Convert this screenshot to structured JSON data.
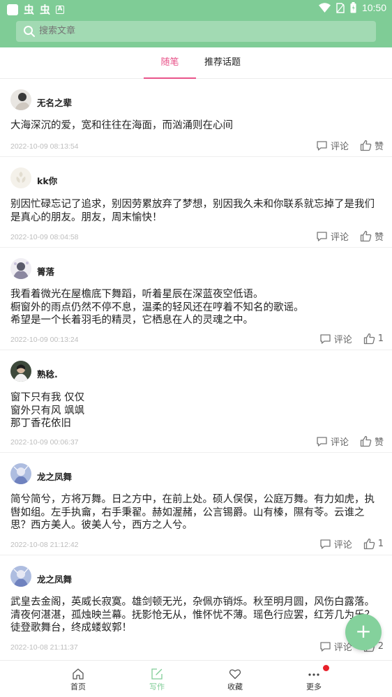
{
  "status_bar": {
    "left_glyphs": [
      "虫",
      "虫"
    ],
    "a_icon_letter": "A",
    "time": "10:50"
  },
  "search": {
    "placeholder": "搜索文章"
  },
  "tabs": [
    {
      "label": "随笔",
      "active": true
    },
    {
      "label": "推荐话题",
      "active": false
    }
  ],
  "posts": [
    {
      "username": "无名之辈",
      "content": "大海深沉的爱，宽和往往在海面，而汹涌则在心间",
      "timestamp": "2022-10-09 08:13:54",
      "comment_label": "评论",
      "like_label": "赞"
    },
    {
      "username": "kk你",
      "content": "别因忙碌忘记了追求，别因劳累放弃了梦想，别因我久未和你联系就忘掉了是我们是真心的朋友。朋友，周末愉快！",
      "timestamp": "2022-10-09 08:04:58",
      "comment_label": "评论",
      "like_label": "赞"
    },
    {
      "username": "箐落",
      "content": "我看着微光在屋檐底下舞蹈，听着星辰在深蓝夜空低语。\n橱窗外的雨点仍然不停不息，温柔的轻风还在哼着不知名的歌谣。\n希望是一个长着羽毛的精灵，它栖息在人的灵魂之中。",
      "timestamp": "2022-10-09 00:13:24",
      "comment_label": "评论",
      "like_label": "1"
    },
    {
      "username": "熟稔.",
      "content": "窗下只有我   仅仅\n窗外只有风    飒飒\n那丁香花依旧",
      "timestamp": "2022-10-09 00:06:37",
      "comment_label": "评论",
      "like_label": "赞"
    },
    {
      "username": "龙之凤舞",
      "content": "简兮简兮，方将万舞。日之方中，在前上处。硕人俣俣，公庭万舞。有力如虎，执辔如组。左手执龠，右手秉翟。赫如渥赭，公言锡爵。山有榛，隰有苓。云谁之思？西方美人。彼美人兮，西方之人兮。",
      "timestamp": "2022-10-08 21:12:42",
      "comment_label": "评论",
      "like_label": "1"
    },
    {
      "username": "龙之凤舞",
      "content": "武皇去金阁，英威长寂寞。雄剑顿无光，杂佩亦销烁。秋至明月圆，风伤白露落。清夜何湛湛，孤烛映兰幕。抚影怆无从，惟怀忧不薄。瑶色行应罢，红芳几为乐？徒登歌舞台，终成蝼蚁郭！",
      "timestamp": "2022-10-08 21:11:37",
      "comment_label": "评论",
      "like_label": "2"
    }
  ],
  "bottom_nav": [
    {
      "label": "首页",
      "icon": "home-icon",
      "active": false
    },
    {
      "label": "写作",
      "icon": "edit-icon",
      "active": true
    },
    {
      "label": "收藏",
      "icon": "heart-icon",
      "active": false
    },
    {
      "label": "更多",
      "icon": "more-icon",
      "active": false,
      "badge": true
    }
  ],
  "fab": {
    "symbol": "+"
  },
  "colors": {
    "theme_green": "#7fcc96",
    "accent_pink": "#e8548a",
    "badge_red": "#e8202a"
  }
}
